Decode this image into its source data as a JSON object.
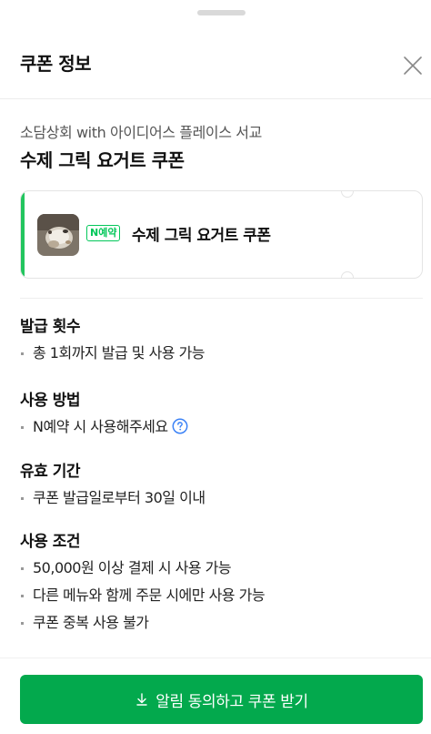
{
  "header": {
    "title": "쿠폰 정보",
    "close_icon": "close-icon"
  },
  "coupon": {
    "store": "소담상회 with 아이디어스 플레이스 서교",
    "title": "수제 그릭 요거트 쿠폰",
    "badge": "N예약",
    "ticket_name": "수제 그릭 요거트 쿠폰",
    "accent_color": "#22c55e",
    "badge_color": "#03c75a"
  },
  "sections": [
    {
      "heading": "발급 횟수",
      "items": [
        "총 1회까지 발급 및 사용 가능"
      ]
    },
    {
      "heading": "사용 방법",
      "items": [
        "N예약 시 사용해주세요"
      ]
    },
    {
      "heading": "유효 기간",
      "items": [
        "쿠폰 발급일로부터 30일 이내"
      ]
    },
    {
      "heading": "사용 조건",
      "items": [
        "50,000원 이상 결제 시 사용 가능",
        "다른 메뉴와 함께 주문 시에만 사용 가능",
        "쿠폰 중복 사용 불가"
      ]
    }
  ],
  "cta": {
    "label": "알림 동의하고 쿠폰 받기",
    "icon": "download-icon",
    "color": "#03a94d"
  }
}
